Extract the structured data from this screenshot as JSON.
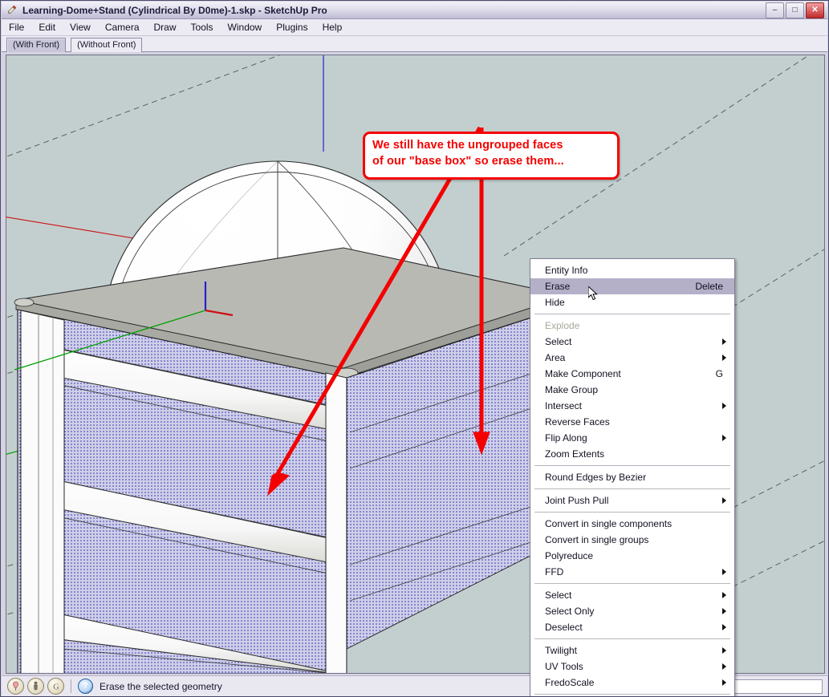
{
  "window": {
    "title": "Learning-Dome+Stand (Cylindrical By D0me)-1.skp  -  SketchUp Pro",
    "app_icon": "pencil-icon",
    "controls": {
      "minimize": "–",
      "maximize": "□",
      "close": "✕"
    }
  },
  "menubar": {
    "items": [
      {
        "label": "File"
      },
      {
        "label": "Edit"
      },
      {
        "label": "View"
      },
      {
        "label": "Camera"
      },
      {
        "label": "Draw"
      },
      {
        "label": "Tools"
      },
      {
        "label": "Window"
      },
      {
        "label": "Plugins"
      },
      {
        "label": "Help"
      }
    ]
  },
  "scene_tabs": {
    "tabs": [
      {
        "label": "(With Front)",
        "active": true
      },
      {
        "label": "(Without Front)",
        "active": false
      }
    ]
  },
  "viewport": {
    "background_color": "#c3cfcf",
    "axis_colors": {
      "red": "#cc1111",
      "green": "#00a000",
      "blue": "#2222cc"
    },
    "model": {
      "dome_color": "#ffffff",
      "top_face_color": "#b9b9b4",
      "selected_face_color": "#c5c5e2",
      "selection_dot_color": "#2020b0",
      "edge_color": "#1a1a1a"
    }
  },
  "callout": {
    "border_color": "#f40000",
    "text_color": "#f40000",
    "lines": [
      "We still have the ungrouped faces",
      "of our \"base box\" so erase them..."
    ],
    "arrows": 2
  },
  "context_menu": {
    "highlight_color": "#b3b0c8",
    "groups": [
      {
        "items": [
          {
            "label": "Entity Info",
            "accel": "",
            "submenu": false,
            "disabled": false,
            "highlighted": false
          },
          {
            "label": "Erase",
            "accel": "Delete",
            "submenu": false,
            "disabled": false,
            "highlighted": true
          },
          {
            "label": "Hide",
            "accel": "",
            "submenu": false,
            "disabled": false,
            "highlighted": false
          }
        ]
      },
      {
        "items": [
          {
            "label": "Explode",
            "accel": "",
            "submenu": false,
            "disabled": true,
            "highlighted": false
          },
          {
            "label": "Select",
            "accel": "",
            "submenu": true,
            "disabled": false,
            "highlighted": false
          },
          {
            "label": "Area",
            "accel": "",
            "submenu": true,
            "disabled": false,
            "highlighted": false
          },
          {
            "label": "Make Component",
            "accel": "G",
            "submenu": false,
            "disabled": false,
            "highlighted": false
          },
          {
            "label": "Make Group",
            "accel": "",
            "submenu": false,
            "disabled": false,
            "highlighted": false
          },
          {
            "label": "Intersect",
            "accel": "",
            "submenu": true,
            "disabled": false,
            "highlighted": false
          },
          {
            "label": "Reverse Faces",
            "accel": "",
            "submenu": false,
            "disabled": false,
            "highlighted": false
          },
          {
            "label": "Flip Along",
            "accel": "",
            "submenu": true,
            "disabled": false,
            "highlighted": false
          },
          {
            "label": "Zoom Extents",
            "accel": "",
            "submenu": false,
            "disabled": false,
            "highlighted": false
          }
        ]
      },
      {
        "items": [
          {
            "label": "Round Edges by Bezier",
            "accel": "",
            "submenu": false,
            "disabled": false,
            "highlighted": false
          }
        ]
      },
      {
        "items": [
          {
            "label": "Joint Push Pull",
            "accel": "",
            "submenu": true,
            "disabled": false,
            "highlighted": false
          }
        ]
      },
      {
        "items": [
          {
            "label": "Convert in single components",
            "accel": "",
            "submenu": false,
            "disabled": false,
            "highlighted": false
          },
          {
            "label": "Convert in single groups",
            "accel": "",
            "submenu": false,
            "disabled": false,
            "highlighted": false
          },
          {
            "label": "Polyreduce",
            "accel": "",
            "submenu": false,
            "disabled": false,
            "highlighted": false
          },
          {
            "label": "FFD",
            "accel": "",
            "submenu": true,
            "disabled": false,
            "highlighted": false
          }
        ]
      },
      {
        "items": [
          {
            "label": "Select",
            "accel": "",
            "submenu": true,
            "disabled": false,
            "highlighted": false
          },
          {
            "label": "Select Only",
            "accel": "",
            "submenu": true,
            "disabled": false,
            "highlighted": false
          },
          {
            "label": "Deselect",
            "accel": "",
            "submenu": true,
            "disabled": false,
            "highlighted": false
          }
        ]
      },
      {
        "items": [
          {
            "label": "Twilight",
            "accel": "",
            "submenu": true,
            "disabled": false,
            "highlighted": false
          },
          {
            "label": "UV Tools",
            "accel": "",
            "submenu": true,
            "disabled": false,
            "highlighted": false
          },
          {
            "label": "FredoScale",
            "accel": "",
            "submenu": true,
            "disabled": false,
            "highlighted": false
          }
        ]
      }
    ]
  },
  "statusbar": {
    "icons": [
      "location-pin-icon",
      "person-icon",
      "google-g-icon"
    ],
    "help_icon": "?",
    "message": "Erase the selected geometry",
    "measurement_value": ""
  }
}
